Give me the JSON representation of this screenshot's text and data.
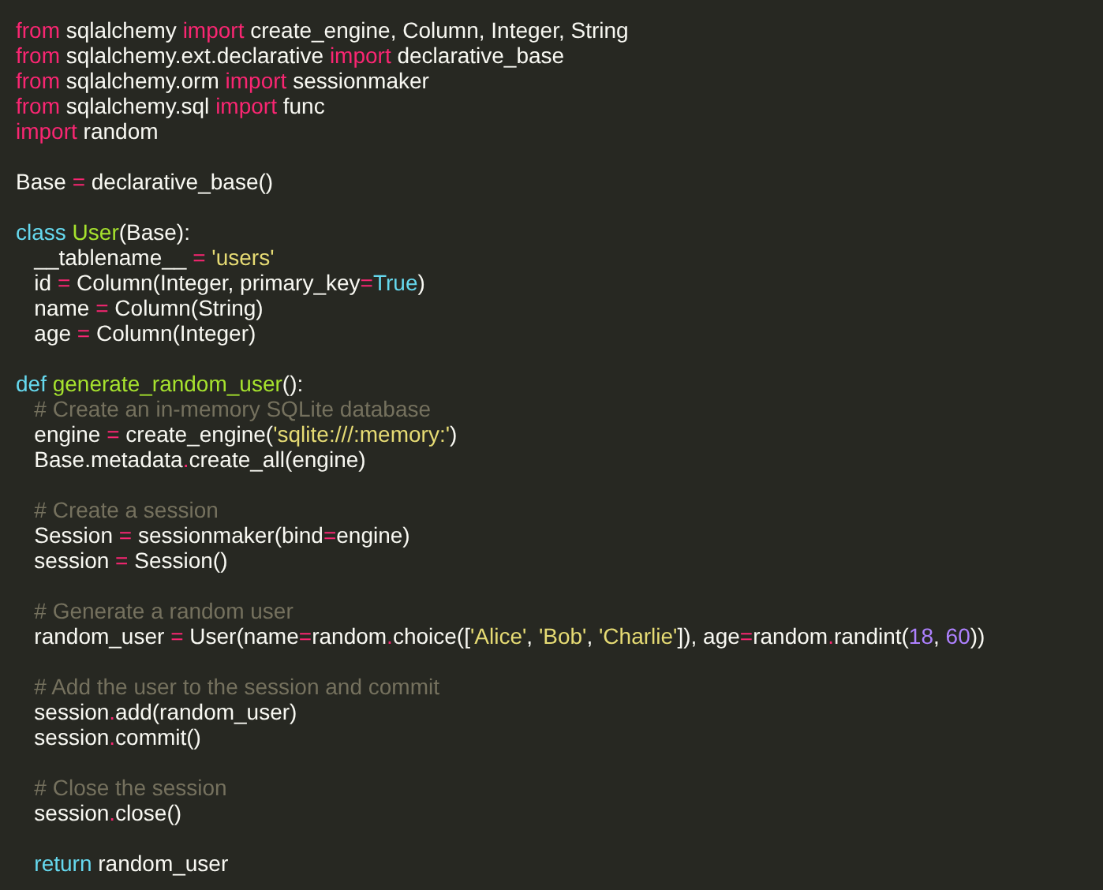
{
  "editor": {
    "lines": [
      {
        "kind": "code",
        "tokens": [
          {
            "text": "from",
            "kind": "keyword"
          },
          {
            "text": " sqlalchemy ",
            "kind": "plain"
          },
          {
            "text": "import",
            "kind": "keyword"
          },
          {
            "text": " create_engine, Column, Integer, String",
            "kind": "plain"
          }
        ]
      },
      {
        "kind": "code",
        "tokens": [
          {
            "text": "from",
            "kind": "keyword"
          },
          {
            "text": " sqlalchemy.ext.declarative ",
            "kind": "plain"
          },
          {
            "text": "import",
            "kind": "keyword"
          },
          {
            "text": " declarative_base",
            "kind": "plain"
          }
        ]
      },
      {
        "kind": "code",
        "tokens": [
          {
            "text": "from",
            "kind": "keyword"
          },
          {
            "text": " sqlalchemy.orm ",
            "kind": "plain"
          },
          {
            "text": "import",
            "kind": "keyword"
          },
          {
            "text": " sessionmaker",
            "kind": "plain"
          }
        ]
      },
      {
        "kind": "code",
        "tokens": [
          {
            "text": "from",
            "kind": "keyword"
          },
          {
            "text": " sqlalchemy.sql ",
            "kind": "plain"
          },
          {
            "text": "import",
            "kind": "keyword"
          },
          {
            "text": " func",
            "kind": "plain"
          }
        ]
      },
      {
        "kind": "code",
        "tokens": [
          {
            "text": "import",
            "kind": "keyword"
          },
          {
            "text": " random",
            "kind": "plain"
          }
        ]
      },
      {
        "kind": "blank"
      },
      {
        "kind": "code",
        "tokens": [
          {
            "text": "Base ",
            "kind": "plain"
          },
          {
            "text": "=",
            "kind": "operator"
          },
          {
            "text": " declarative_base()",
            "kind": "plain"
          }
        ]
      },
      {
        "kind": "blank"
      },
      {
        "kind": "code",
        "tokens": [
          {
            "text": "class ",
            "kind": "declaration"
          },
          {
            "text": "User",
            "kind": "name"
          },
          {
            "text": "(Base):",
            "kind": "plain"
          }
        ]
      },
      {
        "kind": "code",
        "tokens": [
          {
            "text": "   __tablename__ ",
            "kind": "plain"
          },
          {
            "text": "=",
            "kind": "operator"
          },
          {
            "text": " 'users'",
            "kind": "string"
          }
        ]
      },
      {
        "kind": "code",
        "tokens": [
          {
            "text": "   id ",
            "kind": "plain"
          },
          {
            "text": "=",
            "kind": "operator"
          },
          {
            "text": " Column(Integer, primary_key",
            "kind": "plain"
          },
          {
            "text": "=",
            "kind": "operator"
          },
          {
            "text": "True",
            "kind": "declaration"
          },
          {
            "text": ")",
            "kind": "plain"
          }
        ]
      },
      {
        "kind": "code",
        "tokens": [
          {
            "text": "   name ",
            "kind": "plain"
          },
          {
            "text": "=",
            "kind": "operator"
          },
          {
            "text": " Column(String)",
            "kind": "plain"
          }
        ]
      },
      {
        "kind": "code",
        "tokens": [
          {
            "text": "   age ",
            "kind": "plain"
          },
          {
            "text": "=",
            "kind": "operator"
          },
          {
            "text": " Column(Integer)",
            "kind": "plain"
          }
        ]
      },
      {
        "kind": "blank"
      },
      {
        "kind": "code",
        "tokens": [
          {
            "text": "def ",
            "kind": "declaration"
          },
          {
            "text": "generate_random_user",
            "kind": "name"
          },
          {
            "text": "():",
            "kind": "plain"
          }
        ]
      },
      {
        "kind": "code",
        "tokens": [
          {
            "text": "   # Create an in-memory SQLite database",
            "kind": "comment"
          }
        ]
      },
      {
        "kind": "code",
        "tokens": [
          {
            "text": "   engine ",
            "kind": "plain"
          },
          {
            "text": "=",
            "kind": "operator"
          },
          {
            "text": " create_engine(",
            "kind": "plain"
          },
          {
            "text": "'sqlite:///:memory:'",
            "kind": "string"
          },
          {
            "text": ")",
            "kind": "plain"
          }
        ]
      },
      {
        "kind": "code",
        "tokens": [
          {
            "text": "   Base.metadata",
            "kind": "plain"
          },
          {
            "text": ".",
            "kind": "operator"
          },
          {
            "text": "create_all(engine)",
            "kind": "plain"
          }
        ]
      },
      {
        "kind": "blank"
      },
      {
        "kind": "code",
        "tokens": [
          {
            "text": "   # Create a session",
            "kind": "comment"
          }
        ]
      },
      {
        "kind": "code",
        "tokens": [
          {
            "text": "   Session ",
            "kind": "plain"
          },
          {
            "text": "=",
            "kind": "operator"
          },
          {
            "text": " sessionmaker(bind",
            "kind": "plain"
          },
          {
            "text": "=",
            "kind": "operator"
          },
          {
            "text": "engine)",
            "kind": "plain"
          }
        ]
      },
      {
        "kind": "code",
        "tokens": [
          {
            "text": "   session ",
            "kind": "plain"
          },
          {
            "text": "=",
            "kind": "operator"
          },
          {
            "text": " Session()",
            "kind": "plain"
          }
        ]
      },
      {
        "kind": "blank"
      },
      {
        "kind": "code",
        "tokens": [
          {
            "text": "   # Generate a random user",
            "kind": "comment"
          }
        ]
      },
      {
        "kind": "code",
        "tokens": [
          {
            "text": "   random_user ",
            "kind": "plain"
          },
          {
            "text": "=",
            "kind": "operator"
          },
          {
            "text": " User(name",
            "kind": "plain"
          },
          {
            "text": "=",
            "kind": "operator"
          },
          {
            "text": "random",
            "kind": "plain"
          },
          {
            "text": ".",
            "kind": "operator"
          },
          {
            "text": "choice([",
            "kind": "plain"
          },
          {
            "text": "'Alice'",
            "kind": "string"
          },
          {
            "text": ", ",
            "kind": "plain"
          },
          {
            "text": "'Bob'",
            "kind": "string"
          },
          {
            "text": ", ",
            "kind": "plain"
          },
          {
            "text": "'Charlie'",
            "kind": "string"
          },
          {
            "text": "]), age",
            "kind": "plain"
          },
          {
            "text": "=",
            "kind": "operator"
          },
          {
            "text": "random",
            "kind": "plain"
          },
          {
            "text": ".",
            "kind": "operator"
          },
          {
            "text": "randint(",
            "kind": "plain"
          },
          {
            "text": "18",
            "kind": "number"
          },
          {
            "text": ", ",
            "kind": "plain"
          },
          {
            "text": "60",
            "kind": "number"
          },
          {
            "text": "))",
            "kind": "plain"
          }
        ]
      },
      {
        "kind": "blank"
      },
      {
        "kind": "code",
        "tokens": [
          {
            "text": "   # Add the user to the session and commit",
            "kind": "comment"
          }
        ]
      },
      {
        "kind": "code",
        "tokens": [
          {
            "text": "   session",
            "kind": "plain"
          },
          {
            "text": ".",
            "kind": "operator"
          },
          {
            "text": "add(random_user)",
            "kind": "plain"
          }
        ]
      },
      {
        "kind": "code",
        "tokens": [
          {
            "text": "   session",
            "kind": "plain"
          },
          {
            "text": ".",
            "kind": "operator"
          },
          {
            "text": "commit()",
            "kind": "plain"
          }
        ]
      },
      {
        "kind": "blank"
      },
      {
        "kind": "code",
        "tokens": [
          {
            "text": "   # Close the session",
            "kind": "comment"
          }
        ]
      },
      {
        "kind": "code",
        "tokens": [
          {
            "text": "   session",
            "kind": "plain"
          },
          {
            "text": ".",
            "kind": "operator"
          },
          {
            "text": "close()",
            "kind": "plain"
          }
        ]
      },
      {
        "kind": "blank"
      },
      {
        "kind": "code",
        "tokens": [
          {
            "text": "   return",
            "kind": "declaration"
          },
          {
            "text": " random_user",
            "kind": "plain"
          }
        ]
      }
    ]
  }
}
